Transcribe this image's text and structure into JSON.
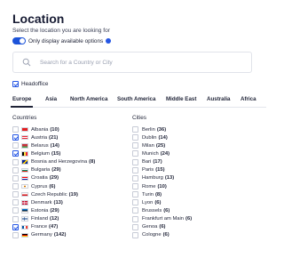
{
  "title": "Location",
  "subtitle": "Select the location you are looking for",
  "toggle": {
    "label": "Only display available options",
    "on": true
  },
  "search": {
    "placeholder": "Search for a Country or City"
  },
  "headoffice": {
    "label": "Headoffice",
    "checked": true
  },
  "tabs": [
    "Europe",
    "Asia",
    "North America",
    "South America",
    "Middle East",
    "Australia",
    "Africa"
  ],
  "colors": {
    "accent": "#2556e4",
    "toggle": "#1c53d9"
  },
  "countries": {
    "header": "Countries",
    "items": [
      {
        "name": "Albania",
        "count": "(10)",
        "checked": false,
        "flag": "albania"
      },
      {
        "name": "Austria",
        "count": "(21)",
        "checked": true,
        "flag": "austria"
      },
      {
        "name": "Belarus",
        "count": "(14)",
        "checked": false,
        "flag": "belarus"
      },
      {
        "name": "Belgium",
        "count": "(15)",
        "checked": true,
        "flag": "belgium"
      },
      {
        "name": "Bosnia and Herzegovina",
        "count": "(8)",
        "checked": false,
        "flag": "bosnia"
      },
      {
        "name": "Bulgaria",
        "count": "(29)",
        "checked": false,
        "flag": "bulgaria"
      },
      {
        "name": "Croatia",
        "count": "(29)",
        "checked": false,
        "flag": "croatia"
      },
      {
        "name": "Cyprus",
        "count": "(6)",
        "checked": false,
        "flag": "cyprus"
      },
      {
        "name": "Czech Republic",
        "count": "(19)",
        "checked": false,
        "flag": "czech"
      },
      {
        "name": "Denmark",
        "count": "(13)",
        "checked": false,
        "flag": "denmark"
      },
      {
        "name": "Estonia",
        "count": "(29)",
        "checked": false,
        "flag": "estonia"
      },
      {
        "name": "Finland",
        "count": "(12)",
        "checked": false,
        "flag": "finland"
      },
      {
        "name": "France",
        "count": "(47)",
        "checked": true,
        "flag": "france"
      },
      {
        "name": "Germany",
        "count": "(142)",
        "checked": false,
        "flag": "germany"
      }
    ]
  },
  "cities": {
    "header": "Cities",
    "items": [
      {
        "name": "Berlin",
        "count": "(36)"
      },
      {
        "name": "Dublin",
        "count": "(14)"
      },
      {
        "name": "Milan",
        "count": "(25)"
      },
      {
        "name": "Munich",
        "count": "(24)"
      },
      {
        "name": "Bari",
        "count": "(17)"
      },
      {
        "name": "Paris",
        "count": "(15)"
      },
      {
        "name": "Hamburg",
        "count": "(13)"
      },
      {
        "name": "Rome",
        "count": "(10)"
      },
      {
        "name": "Turin",
        "count": "(8)"
      },
      {
        "name": "Lyon",
        "count": "(6)"
      },
      {
        "name": "Brussels",
        "count": "(6)"
      },
      {
        "name": "Frankfurt am Main",
        "count": "(6)"
      },
      {
        "name": "Genoa",
        "count": "(6)"
      },
      {
        "name": "Cologne",
        "count": "(6)"
      }
    ]
  }
}
